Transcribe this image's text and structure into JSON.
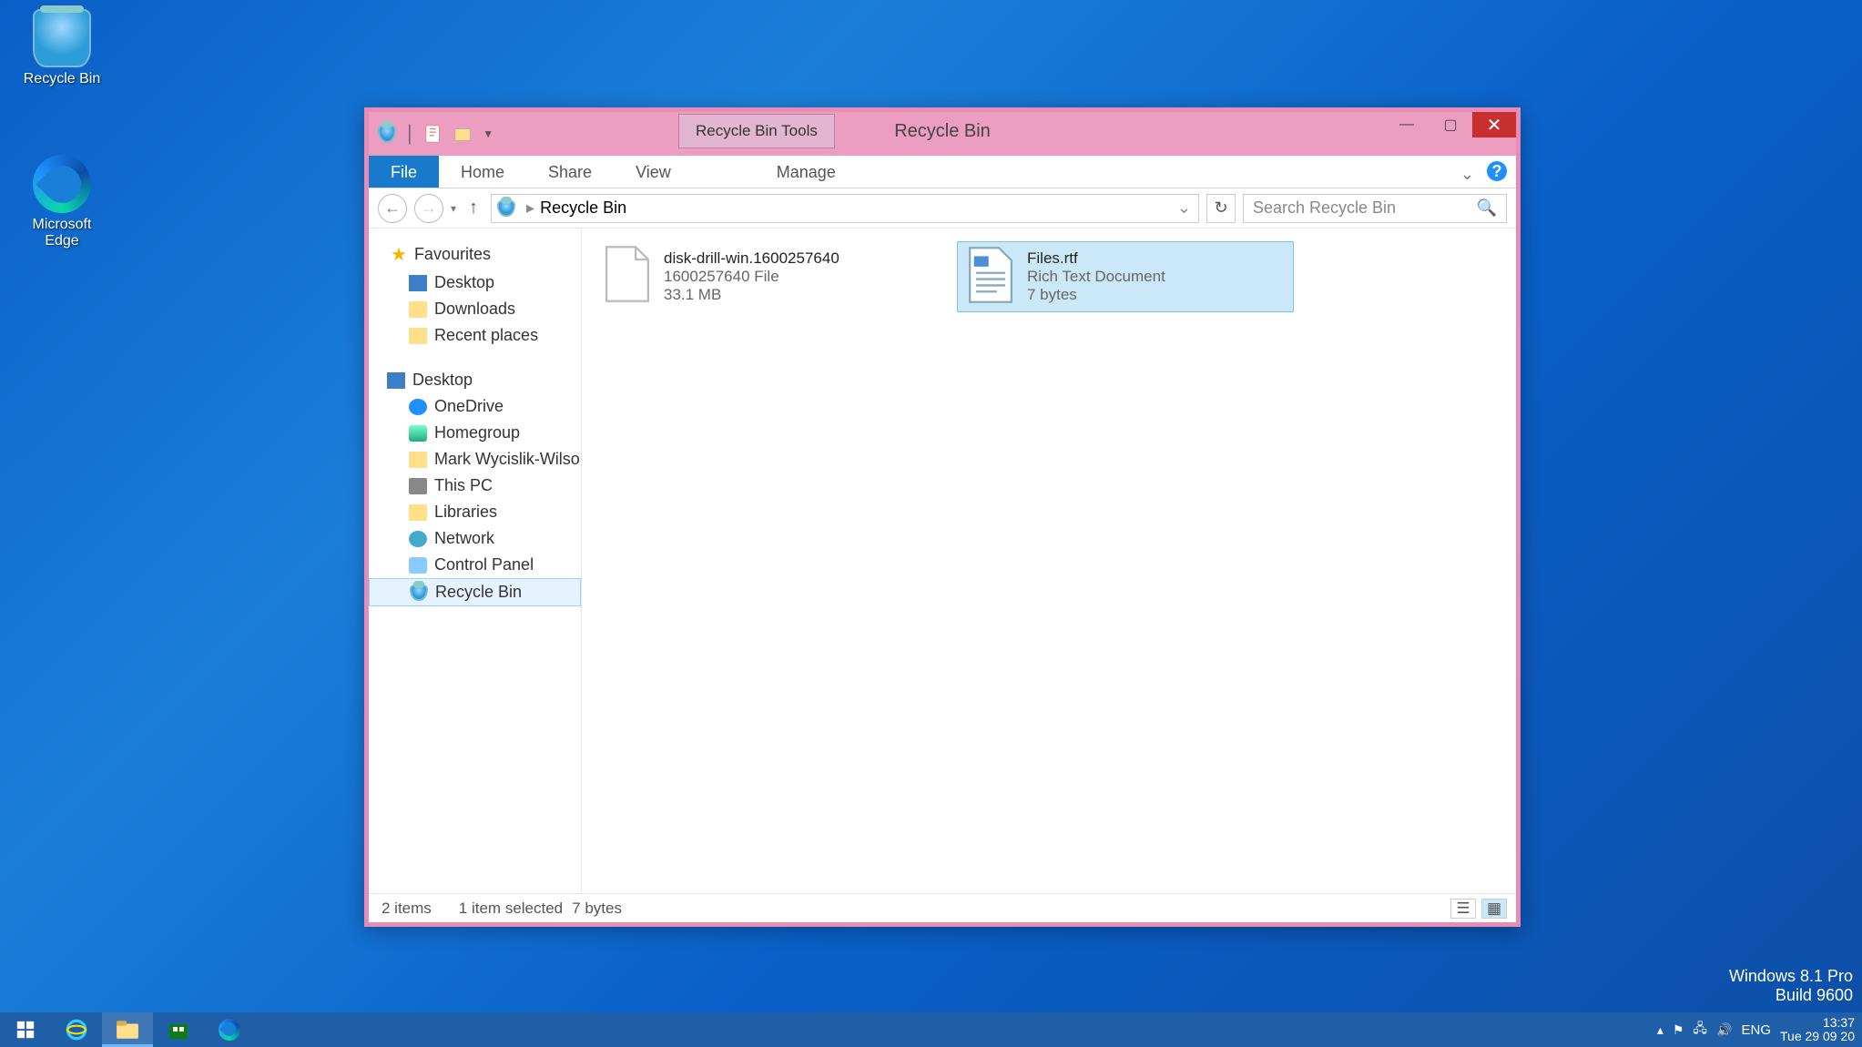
{
  "desktop": {
    "icons": [
      {
        "name": "Recycle Bin"
      },
      {
        "name": "Microsoft Edge"
      }
    ]
  },
  "window": {
    "tool_tab": "Recycle Bin Tools",
    "title": "Recycle Bin",
    "ribbon": {
      "file": "File",
      "tabs": [
        "Home",
        "Share",
        "View"
      ],
      "context": "Manage"
    },
    "nav": {
      "back_enabled": true,
      "fwd_enabled": false
    },
    "address": {
      "crumbs": [
        "Recycle Bin"
      ]
    },
    "search_placeholder": "Search Recycle Bin",
    "tree": {
      "favourites": "Favourites",
      "fav_items": [
        "Desktop",
        "Downloads",
        "Recent places"
      ],
      "desktop": "Desktop",
      "desk_items": [
        "OneDrive",
        "Homegroup",
        "Mark Wycislik-Wilson",
        "This PC",
        "Libraries",
        "Network",
        "Control Panel",
        "Recycle Bin"
      ]
    },
    "files": [
      {
        "name": "disk-drill-win.1600257640",
        "type": "1600257640 File",
        "size": "33.1 MB",
        "selected": false
      },
      {
        "name": "Files.rtf",
        "type": "Rich Text Document",
        "size": "7 bytes",
        "selected": true
      }
    ],
    "status": {
      "count": "2 items",
      "sel": "1 item selected",
      "size": "7 bytes"
    }
  },
  "brand": {
    "line1": "Windows 8.1 Pro",
    "line2": "Build 9600"
  },
  "taskbar": {
    "lang": "ENG",
    "time": "13:37",
    "date": "Tue 29 09 20"
  }
}
